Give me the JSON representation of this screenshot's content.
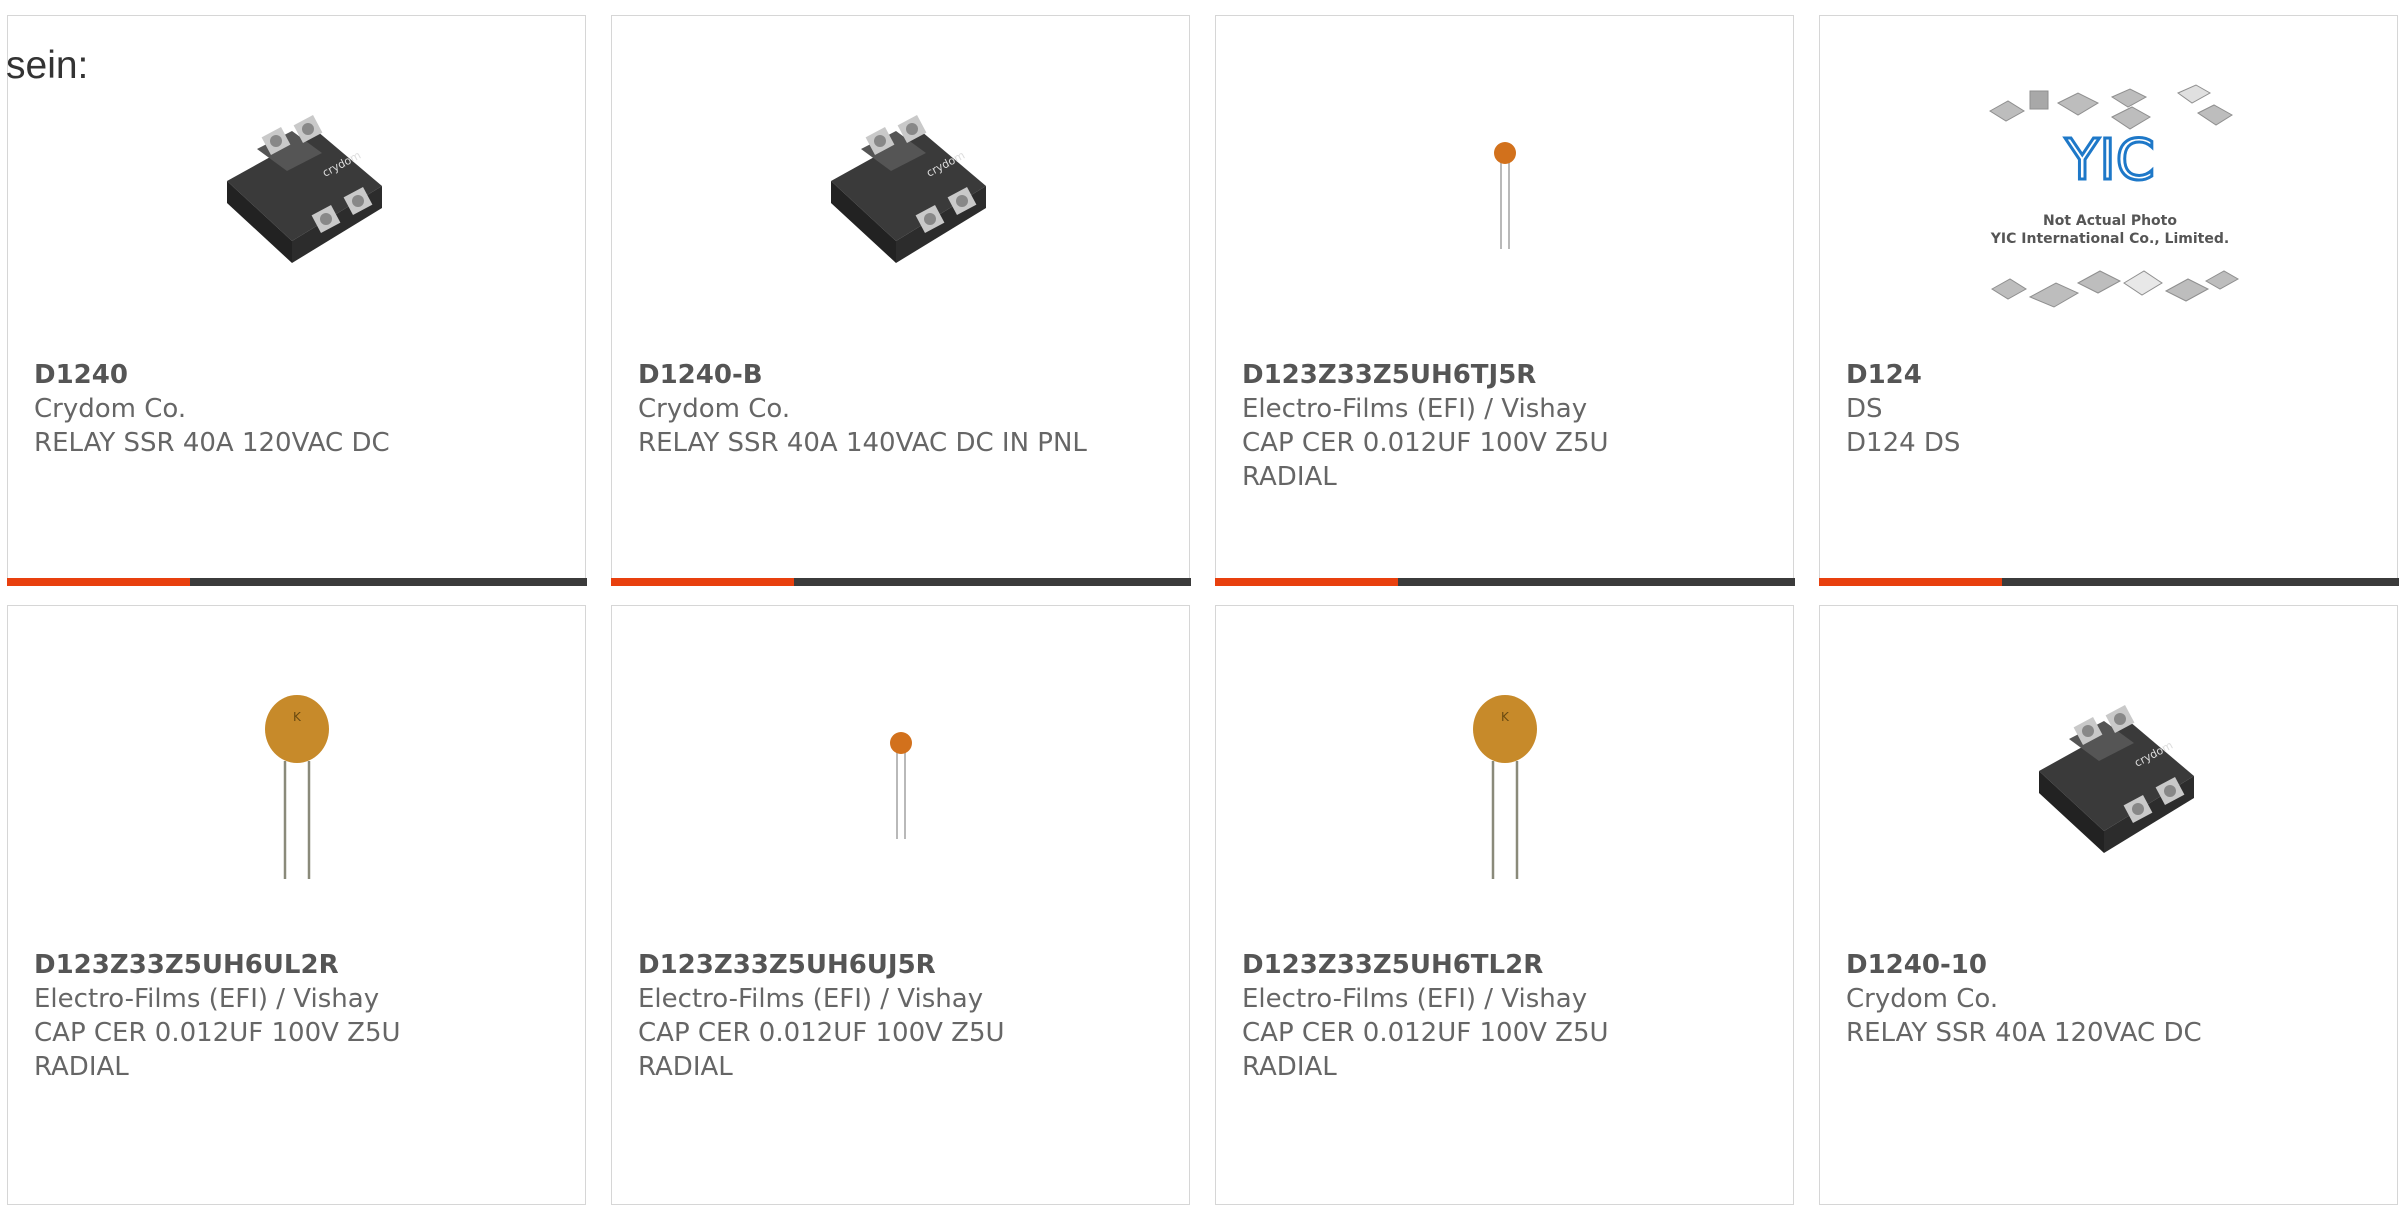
{
  "page": {
    "leading_text": "sein:"
  },
  "colors": {
    "accent": "#e8400e",
    "bar": "#3b3b3b",
    "border": "#d6d6d6",
    "text": "#666666"
  },
  "products": [
    {
      "part_number": "D1240",
      "manufacturer": "Crydom Co.",
      "description": "RELAY SSR 40A 120VAC DC",
      "image": "relay"
    },
    {
      "part_number": "D1240-B",
      "manufacturer": "Crydom Co.",
      "description": "RELAY SSR 40A 140VAC DC IN PNL",
      "image": "relay"
    },
    {
      "part_number": "D123Z33Z5UH6TJ5R",
      "manufacturer": "Electro-Films (EFI) / Vishay",
      "description": "CAP CER 0.012UF 100V Z5U RADIAL",
      "image": "small-capacitor"
    },
    {
      "part_number": "D124",
      "manufacturer": "DS",
      "description": "D124 DS",
      "image": "placeholder",
      "image_text": [
        "Not Actual Photo",
        "YIC International Co., Limited."
      ],
      "image_logo": "YIC"
    },
    {
      "part_number": "D123Z33Z5UH6UL2R",
      "manufacturer": "Electro-Films (EFI) / Vishay",
      "description": "CAP CER 0.012UF 100V Z5U RADIAL",
      "image": "large-capacitor"
    },
    {
      "part_number": "D123Z33Z5UH6UJ5R",
      "manufacturer": "Electro-Films (EFI) / Vishay",
      "description": "CAP CER 0.012UF 100V Z5U RADIAL",
      "image": "small-capacitor"
    },
    {
      "part_number": "D123Z33Z5UH6TL2R",
      "manufacturer": "Electro-Films (EFI) / Vishay",
      "description": "CAP CER 0.012UF 100V Z5U RADIAL",
      "image": "large-capacitor"
    },
    {
      "part_number": "D1240-10",
      "manufacturer": "Crydom Co.",
      "description": "RELAY SSR 40A 120VAC DC",
      "image": "relay"
    }
  ]
}
